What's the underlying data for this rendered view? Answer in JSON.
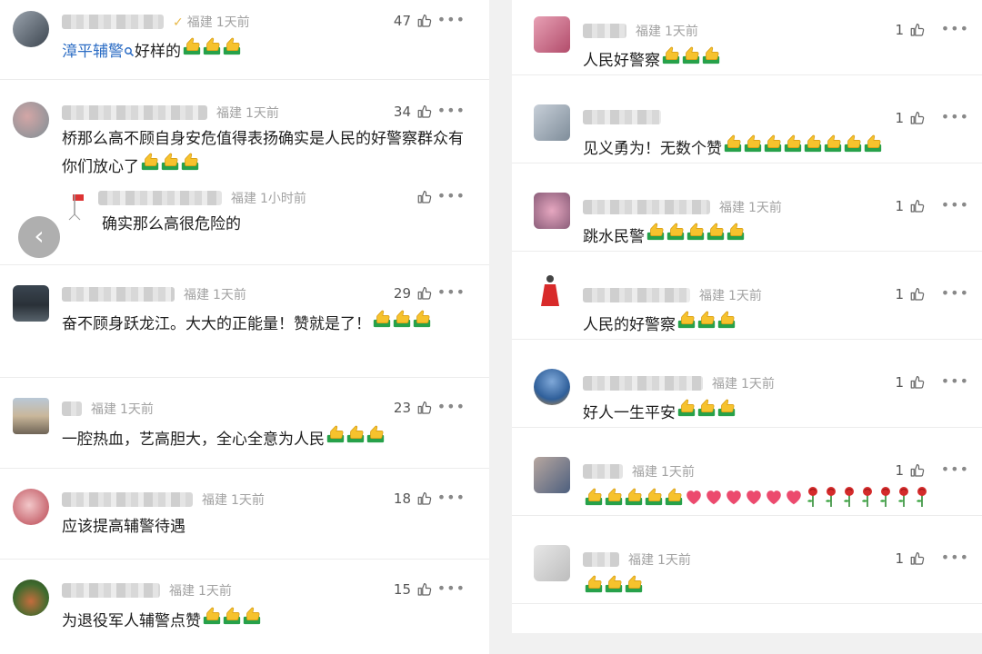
{
  "left": {
    "comments": [
      {
        "location": "福建",
        "time": "1天前",
        "likes": "47",
        "mention": "漳平辅警",
        "mention_icon": "search-icon",
        "text": "好样的",
        "thumbs": 3
      },
      {
        "location": "福建",
        "time": "1天前",
        "likes": "34",
        "text": "桥那么高不顾自身安危值得表扬确实是人民的好警察群众有你们放心了",
        "thumbs": 3
      },
      {
        "location": "福建",
        "time": "1小时前",
        "likes": "",
        "text": "确实那么高很危险的",
        "thumbs": 0,
        "reply": true
      },
      {
        "location": "福建",
        "time": "1天前",
        "likes": "29",
        "text": "奋不顾身跃龙江。大大的正能量！赞就是了！",
        "thumbs": 3
      },
      {
        "location": "福建",
        "time": "1天前",
        "likes": "23",
        "text": "一腔热血，艺高胆大，全心全意为人民",
        "thumbs": 3
      },
      {
        "location": "福建",
        "time": "1天前",
        "likes": "18",
        "text": "应该提高辅警待遇",
        "thumbs": 0
      },
      {
        "location": "福建",
        "time": "1天前",
        "likes": "15",
        "text": "为退役军人辅警点赞",
        "thumbs": 3
      }
    ],
    "back_icon": "chevron-left-icon"
  },
  "right": {
    "comments": [
      {
        "location": "福建",
        "time": "1天前",
        "likes": "1",
        "text": "人民好警察",
        "thumbs": 3
      },
      {
        "location": "",
        "time": "",
        "likes": "1",
        "text": "见义勇为！无数个赞",
        "thumbs": 8
      },
      {
        "location": "福建",
        "time": "1天前",
        "likes": "1",
        "text": "跳水民警",
        "thumbs": 5
      },
      {
        "location": "福建",
        "time": "1天前",
        "likes": "1",
        "text": "人民的好警察",
        "thumbs": 3
      },
      {
        "location": "福建",
        "time": "1天前",
        "likes": "1",
        "text": "好人一生平安",
        "thumbs": 3
      },
      {
        "location": "福建",
        "time": "1天前",
        "likes": "1",
        "text": "",
        "thumbs": 5,
        "hearts": 6,
        "roses": 7
      },
      {
        "location": "福建",
        "time": "1天前",
        "likes": "1",
        "text": "",
        "thumbs": 3
      }
    ]
  },
  "icons": {
    "like": "thumbs-up-outline-icon",
    "more": "more-dots-icon",
    "thumb_emoji": "thumbs-up-emoji",
    "heart_emoji": "heart-emoji",
    "rose_emoji": "rose-emoji"
  },
  "colors": {
    "mention": "#2b6cc4",
    "meta": "#a2a2a2",
    "thumb": "#f5c12d",
    "heart": "#ec4a6e",
    "rose": "#d42b2b"
  }
}
